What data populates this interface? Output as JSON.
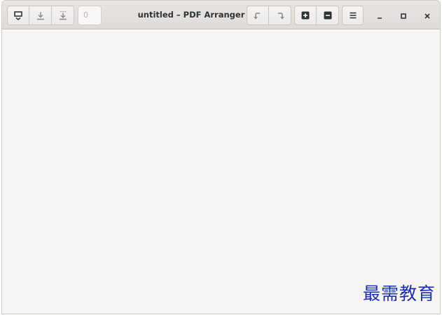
{
  "window": {
    "title": "untitled – PDF Arranger"
  },
  "toolbar": {
    "open_icon": "open-file-icon",
    "save_icon": "save-icon",
    "save_as_icon": "save-as-icon",
    "zoom_value": "0",
    "rotate_left_icon": "rotate-left-icon",
    "rotate_right_icon": "rotate-right-icon",
    "zoom_in_icon": "zoom-in-icon",
    "zoom_out_icon": "zoom-out-icon",
    "menu_icon": "hamburger-menu-icon"
  },
  "window_controls": {
    "minimize_icon": "minimize-icon",
    "maximize_icon": "maximize-icon",
    "close_icon": "close-icon"
  },
  "watermark": {
    "text": "最需教育"
  },
  "colors": {
    "headerbar": "#e4e2df",
    "content_bg": "#f6f5f4",
    "watermark": "#1a2fb8",
    "text": "#2e3436"
  }
}
